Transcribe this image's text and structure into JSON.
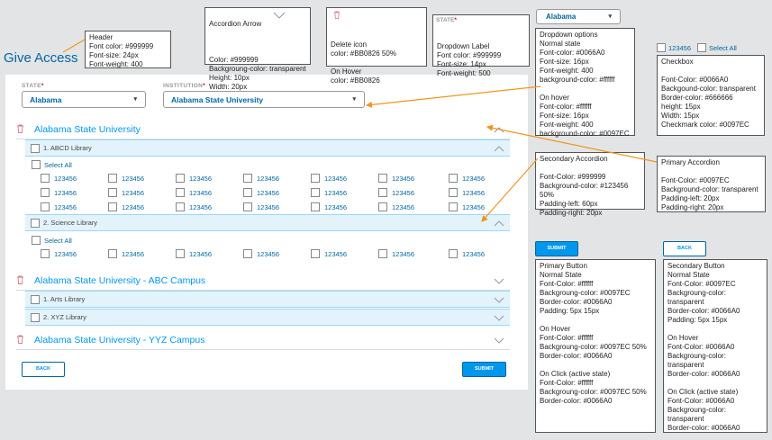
{
  "page_title": "Give Access",
  "state_field": {
    "label": "STATE",
    "required": "*",
    "value": "Alabama"
  },
  "institution_field": {
    "label": "INSTITUTION",
    "required": "*",
    "value": "Alabama State University"
  },
  "accordions": [
    {
      "title": "Alabama State University",
      "expanded": true,
      "libraries": [
        {
          "title": "1. ABCD Library",
          "select_all": "Select All",
          "items": [
            "123456",
            "123456",
            "123456",
            "123456",
            "123456",
            "123456",
            "123456",
            "123456",
            "123456",
            "123456",
            "123456",
            "123456",
            "123456",
            "123456",
            "123456",
            "123456",
            "123456",
            "123456",
            "123456",
            "123456",
            "123456"
          ]
        },
        {
          "title": "2. Science Library",
          "select_all": "Select All",
          "items": [
            "123456",
            "123456",
            "123456",
            "123456",
            "123456",
            "123456",
            "123456"
          ]
        }
      ]
    },
    {
      "title": "Alabama State University - ABC Campus",
      "expanded": true,
      "libraries": [
        {
          "title": "1. Arts Library"
        },
        {
          "title": "2. XYZ Library"
        }
      ]
    },
    {
      "title": "Alabama State University - YYZ Campus",
      "expanded": false
    }
  ],
  "buttons": {
    "back": "BACK",
    "submit": "SUBMIT"
  },
  "specs": {
    "header": "Header\nFont color: #999999\nFont-size: 24px\nFont-weight: 400",
    "accordion_arrow_title": "Accordion Arrow",
    "accordion_arrow": "Color: #999999\nBackgroung-color: transparent\nHeight: 10px\nWidth: 20px",
    "delete_icon": "Delete icon\ncolor: #BB0826 50%\n\nOn Hover\ncolor: #BB0826",
    "dropdown_label_sample": "STATE",
    "dropdown_label": "Dropdown Label\nFont color: #999999\nFont-size: 14px\nFont-weight: 500",
    "dropdown_sample": "Alabama",
    "dropdown_options": "Dropdown options\nNormal state\nFont-color: #0066A0\nFont-size: 16px\nFont-weight: 400\nbackground-color: #ffffff\n\nOn hover\nFont-color: #ffffff\nFont-size: 16px\nFont-weight: 400\nbackground-color: #0097EC",
    "checkbox_sample_num": "123456",
    "checkbox_sample_select": "Select All",
    "checkbox": "Checkbox\n\nFont-Color: #0066A0\nBackgound-color: transparent\nBorder-color: #666666\nheight: 15px\nWidth: 15px\nCheckmark color: #0097EC",
    "secondary_accordion": "Secondary Accordion\n\nFont-Color: #999999\nBackground-color: #123456 50%\nPadding-left: 60px\nPadding-right: 20px",
    "primary_accordion": "Primary Accordion\n\nFont-Color: #0097EC\nBackground-color: transparent\nPadding-left: 20px\nPadding-right: 20px",
    "submit_sample": "SUBMIT",
    "back_sample": "BACK",
    "primary_button": "Primary Button\nNormal State\nFont-Color: #ffffff\nBackgroung-color: #0097EC\nBorder-color: #0066A0\nPadding: 5px 15px\n\nOn Hover\nFont-Color: #ffffff\nBackgroung-color: #0097EC 50%\nBorder-color: #0066A0\n\nOn Click (active state)\nFont-Color: #ffffff\nBackgroung-color: #0097EC 50%\nBorder-color: #0066A0",
    "secondary_button": "Secondary Button\nNormal State\nFont-Color: #0097EC\nBackgroung-color: transparent\nBorder-color: #0066A0\nPadding: 5px 15px\n\nOn Hover\nFont-Color: #0066A0\nBackgroung-color: transparent\nBorder-color: #0066A0\n\nOn Click (active state)\nFont-Color: #0066A0\nBackgroung-color: transparent\nBorder-color: #0066A0"
  },
  "colors": {
    "primary": "#0097EC",
    "dark": "#0066A0",
    "delete": "#BB0826",
    "muted": "#999999"
  }
}
